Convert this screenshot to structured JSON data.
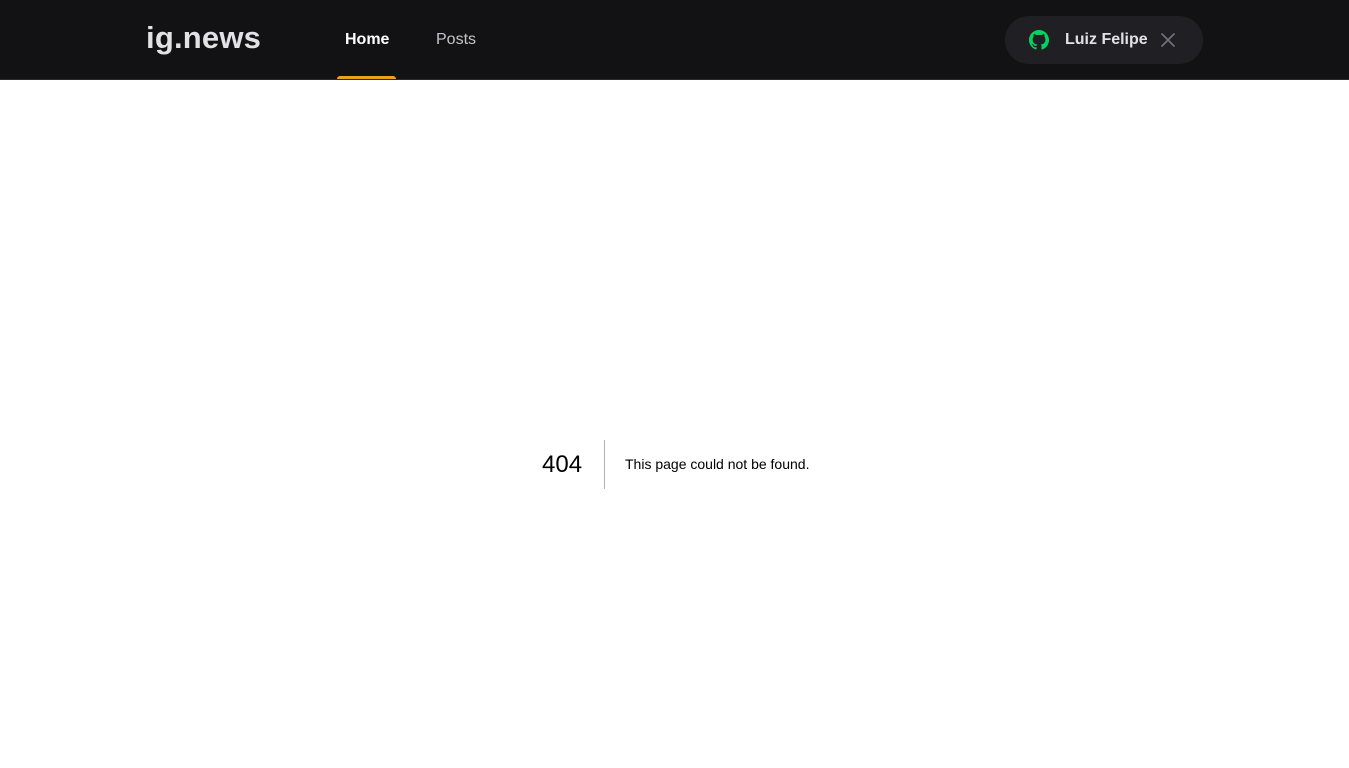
{
  "header": {
    "logo": "ig.news",
    "nav": [
      {
        "label": "Home",
        "active": true
      },
      {
        "label": "Posts",
        "active": false
      }
    ],
    "user": {
      "name": "Luiz Felipe",
      "provider_icon": "github-icon",
      "close_icon": "close-icon"
    }
  },
  "main": {
    "error_code": "404",
    "error_message": "This page could not be found."
  },
  "colors": {
    "header_bg": "#121214",
    "accent": "#eba417",
    "github_green": "#04d361",
    "pill_bg": "#202024"
  }
}
